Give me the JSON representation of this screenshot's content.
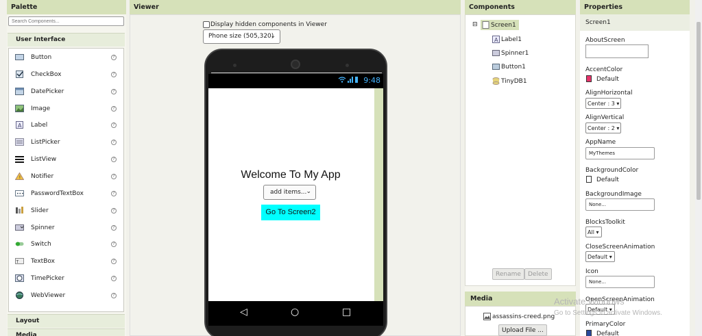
{
  "palette": {
    "title": "Palette",
    "search_placeholder": "Search Components...",
    "category": "User Interface",
    "items": [
      {
        "label": "Button",
        "icon": "button-icon"
      },
      {
        "label": "CheckBox",
        "icon": "checkbox-icon"
      },
      {
        "label": "DatePicker",
        "icon": "datepicker-icon"
      },
      {
        "label": "Image",
        "icon": "image-icon"
      },
      {
        "label": "Label",
        "icon": "label-icon"
      },
      {
        "label": "ListPicker",
        "icon": "listpicker-icon"
      },
      {
        "label": "ListView",
        "icon": "listview-icon"
      },
      {
        "label": "Notifier",
        "icon": "notifier-icon"
      },
      {
        "label": "PasswordTextBox",
        "icon": "passwordtextbox-icon"
      },
      {
        "label": "Slider",
        "icon": "slider-icon"
      },
      {
        "label": "Spinner",
        "icon": "spinner-icon"
      },
      {
        "label": "Switch",
        "icon": "switch-icon"
      },
      {
        "label": "TextBox",
        "icon": "textbox-icon"
      },
      {
        "label": "TimePicker",
        "icon": "timepicker-icon"
      },
      {
        "label": "WebViewer",
        "icon": "webviewer-icon"
      }
    ],
    "help_glyph": "?",
    "layout_category": "Layout",
    "media_category": "Media"
  },
  "viewer": {
    "title": "Viewer",
    "hidden_label": "Display hidden components in Viewer",
    "size_value": "Phone size (505,320)",
    "status_time": "9:48",
    "welcome_text": "Welcome To My App",
    "spinner_text": "add items...",
    "button_text": "Go To Screen2"
  },
  "components": {
    "title": "Components",
    "tree": [
      "Screen1",
      "Label1",
      "Spinner1",
      "Button1",
      "TinyDB1"
    ],
    "collapse_glyph": "⊟",
    "rename_label": "Rename",
    "delete_label": "Delete",
    "media_title": "Media",
    "media_file": "assassins-creed.png",
    "upload_label": "Upload File ..."
  },
  "properties": {
    "title": "Properties",
    "selected": "Screen1",
    "about_label": "AboutScreen",
    "accent_label": "AccentColor",
    "accent_value": "Default",
    "accent_color": "#e8336b",
    "alignh_label": "AlignHorizontal",
    "alignh_value": "Center : 3",
    "alignv_label": "AlignVertical",
    "alignv_value": "Center : 2",
    "appname_label": "AppName",
    "appname_value": "MyThemes",
    "bgcolor_label": "BackgroundColor",
    "bgcolor_value": "Default",
    "bgimage_label": "BackgroundImage",
    "bgimage_value": "None...",
    "blocks_label": "BlocksToolkit",
    "blocks_value": "All",
    "close_label": "CloseScreenAnimation",
    "close_value": "Default",
    "icon_label": "Icon",
    "icon_value": "None...",
    "open_label": "OpenScreenAnimation",
    "open_value": "Default",
    "primary_label": "PrimaryColor",
    "primary_value": "Default",
    "primary_color": "#2a4a9c"
  },
  "watermark": {
    "line1": "Activate Windows",
    "line2": "Go to Settings to activate Windows."
  }
}
